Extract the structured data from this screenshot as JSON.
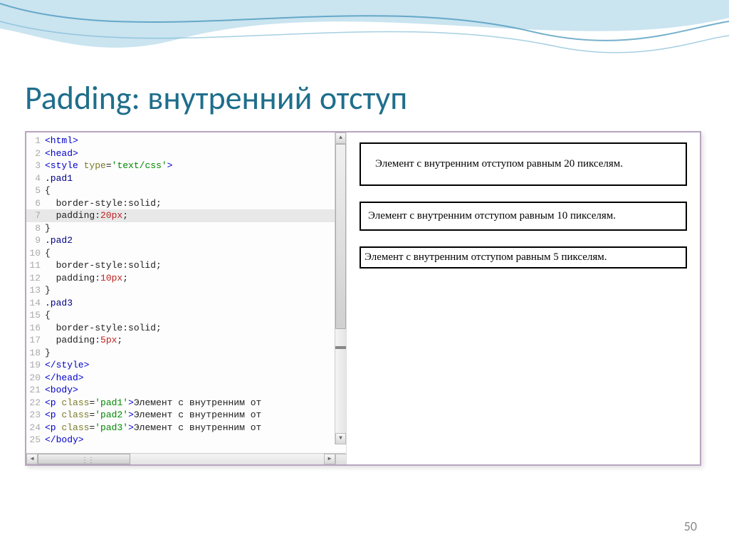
{
  "title": "Padding: внутренний отступ",
  "page_number": "50",
  "code": {
    "highlight_line": 7,
    "lines": [
      {
        "n": 1,
        "html": "<span class='tag'>&lt;html&gt;</span>"
      },
      {
        "n": 2,
        "html": "<span class='tag'>&lt;head&gt;</span>"
      },
      {
        "n": 3,
        "html": "<span class='tag'>&lt;style</span> <span class='attr'>type</span>=<span class='str'>'text/css'</span><span class='tag'>&gt;</span>"
      },
      {
        "n": 4,
        "html": "<span class='sel'>.pad1</span>"
      },
      {
        "n": 5,
        "html": "{"
      },
      {
        "n": 6,
        "html": "  border-style:solid;"
      },
      {
        "n": 7,
        "html": "  padding:<span class='nm'>20px</span>;"
      },
      {
        "n": 8,
        "html": "}"
      },
      {
        "n": 9,
        "html": "<span class='sel'>.pad2</span>"
      },
      {
        "n": 10,
        "html": "{"
      },
      {
        "n": 11,
        "html": "  border-style:solid;"
      },
      {
        "n": 12,
        "html": "  padding:<span class='nm'>10px</span>;"
      },
      {
        "n": 13,
        "html": "}"
      },
      {
        "n": 14,
        "html": "<span class='sel'>.pad3</span>"
      },
      {
        "n": 15,
        "html": "{"
      },
      {
        "n": 16,
        "html": "  border-style:solid;"
      },
      {
        "n": 17,
        "html": "  padding:<span class='nm'>5px</span>;"
      },
      {
        "n": 18,
        "html": "}"
      },
      {
        "n": 19,
        "html": "<span class='tag'>&lt;/style&gt;</span>"
      },
      {
        "n": 20,
        "html": "<span class='tag'>&lt;/head&gt;</span>"
      },
      {
        "n": 21,
        "html": "<span class='tag'>&lt;body&gt;</span>"
      },
      {
        "n": 22,
        "html": "<span class='tag'>&lt;p</span> <span class='attr'>class</span>=<span class='str'>'pad1'</span><span class='tag'>&gt;</span>Элемент с внутренним от"
      },
      {
        "n": 23,
        "html": "<span class='tag'>&lt;p</span> <span class='attr'>class</span>=<span class='str'>'pad2'</span><span class='tag'>&gt;</span>Элемент с внутренним от"
      },
      {
        "n": 24,
        "html": "<span class='tag'>&lt;p</span> <span class='attr'>class</span>=<span class='str'>'pad3'</span><span class='tag'>&gt;</span>Элемент с внутренним от"
      },
      {
        "n": 25,
        "html": "<span class='tag'>&lt;/body&gt;</span>"
      }
    ]
  },
  "preview": {
    "box20": "Элемент с внутренним отступом равным 20 пикселям.",
    "box10": "Элемент с внутренним отступом равным 10 пикселям.",
    "box5": "Элемент с внутренним отступом равным 5 пикселям."
  }
}
